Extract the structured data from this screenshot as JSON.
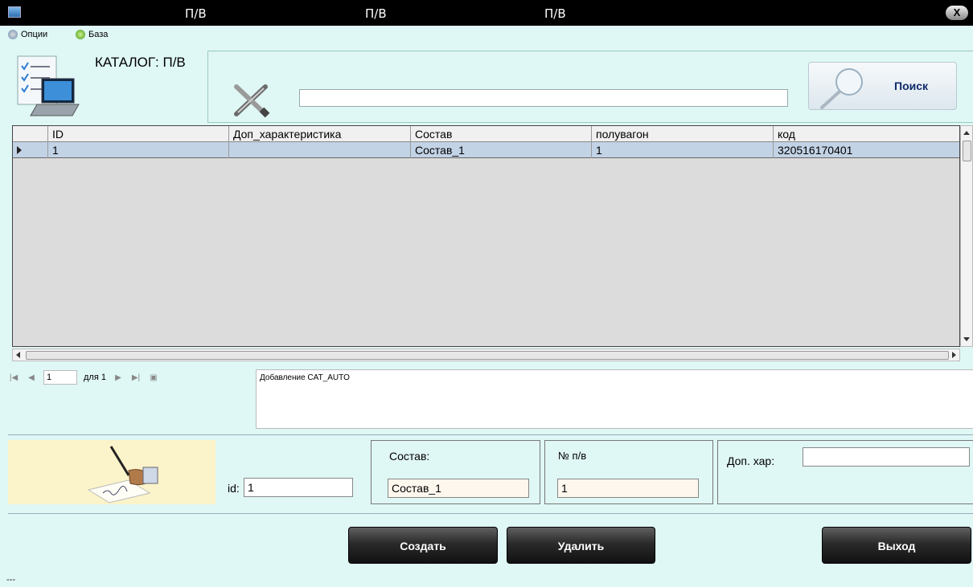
{
  "window": {
    "titles": [
      "П/В",
      "П/В",
      "П/В"
    ],
    "close_label": "X"
  },
  "menu": {
    "items": [
      {
        "label": "Опции",
        "icon": "options-icon"
      },
      {
        "label": "База",
        "icon": "database-icon"
      }
    ]
  },
  "header": {
    "catalog_title": "КАТАЛОГ: П/В",
    "search_value": "",
    "search_button": "Поиск"
  },
  "grid": {
    "columns": [
      "ID",
      "Доп_характеристика",
      "Состав",
      "полувагон",
      "код"
    ],
    "rows": [
      {
        "id": "1",
        "dop": "",
        "sostav": "Состав_1",
        "poluvagon": "1",
        "kod": "320516170401"
      }
    ]
  },
  "navigator": {
    "position": "1",
    "of_label": "для 1"
  },
  "log": {
    "text": "Добавление CAT_AUTO"
  },
  "form": {
    "id_label": "id:",
    "id_value": "1",
    "sostav_label": "Состав:",
    "sostav_value": "Состав_1",
    "num_label": "№ п/в",
    "num_value": "1",
    "dop_label": "Доп. хар:",
    "dop_value": ""
  },
  "buttons": {
    "create": "Создать",
    "delete": "Удалить",
    "exit": "Выход"
  },
  "status": {
    "text": "---"
  },
  "colors": {
    "background": "#dff7f5",
    "selected_row": "#c3d3e6",
    "button_dark": "#1a1a1a",
    "search_text": "#0f2a6a"
  }
}
